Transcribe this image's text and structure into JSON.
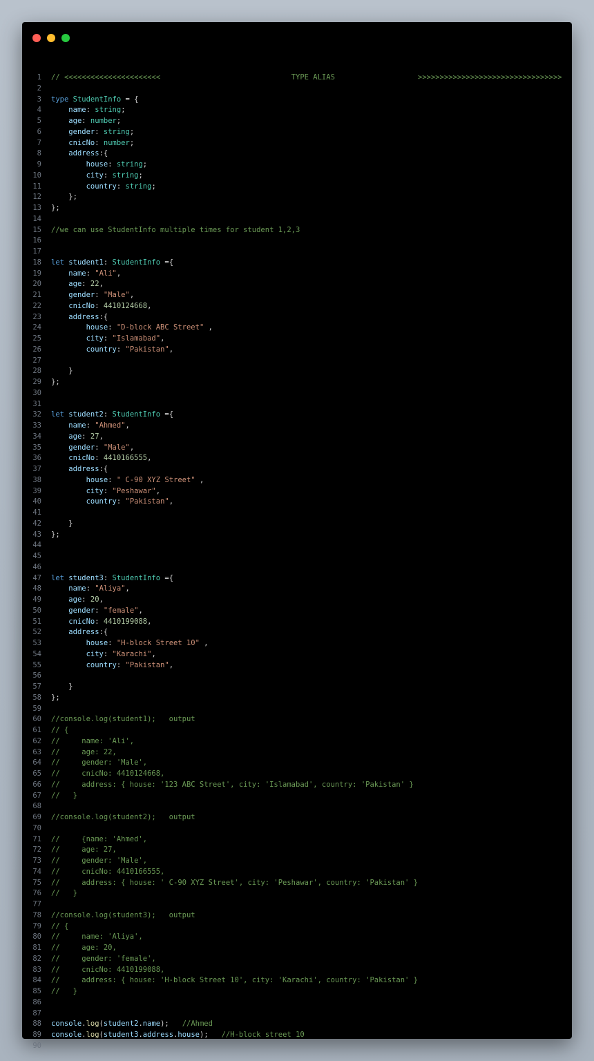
{
  "window": {
    "controls": [
      {
        "name": "close",
        "color": "#ff5f56"
      },
      {
        "name": "minimize",
        "color": "#ffbd2e"
      },
      {
        "name": "maximize",
        "color": "#27c93f"
      }
    ]
  },
  "lines": [
    [
      [
        "cm",
        "// <<<<<<<<<<<<<<<<<<<<<<                              TYPE ALIAS                   >>>>>>>>>>>>>>>>>>>>>>>>>>>>>>>>>"
      ]
    ],
    [],
    [
      [
        "kw",
        "type"
      ],
      [
        "p",
        " "
      ],
      [
        "ty",
        "StudentInfo"
      ],
      [
        "p",
        " = {"
      ]
    ],
    [
      [
        "p",
        "    "
      ],
      [
        "pr",
        "name"
      ],
      [
        "p",
        ": "
      ],
      [
        "ty",
        "string"
      ],
      [
        "p",
        ";"
      ]
    ],
    [
      [
        "p",
        "    "
      ],
      [
        "pr",
        "age"
      ],
      [
        "p",
        ": "
      ],
      [
        "ty",
        "number"
      ],
      [
        "p",
        ";"
      ]
    ],
    [
      [
        "p",
        "    "
      ],
      [
        "pr",
        "gender"
      ],
      [
        "p",
        ": "
      ],
      [
        "ty",
        "string"
      ],
      [
        "p",
        ";"
      ]
    ],
    [
      [
        "p",
        "    "
      ],
      [
        "pr",
        "cnicNo"
      ],
      [
        "p",
        ": "
      ],
      [
        "ty",
        "number"
      ],
      [
        "p",
        ";"
      ]
    ],
    [
      [
        "p",
        "    "
      ],
      [
        "pr",
        "address"
      ],
      [
        "p",
        ":{"
      ]
    ],
    [
      [
        "p",
        "        "
      ],
      [
        "pr",
        "house"
      ],
      [
        "p",
        ": "
      ],
      [
        "ty",
        "string"
      ],
      [
        "p",
        ";"
      ]
    ],
    [
      [
        "p",
        "        "
      ],
      [
        "pr",
        "city"
      ],
      [
        "p",
        ": "
      ],
      [
        "ty",
        "string"
      ],
      [
        "p",
        ";"
      ]
    ],
    [
      [
        "p",
        "        "
      ],
      [
        "pr",
        "country"
      ],
      [
        "p",
        ": "
      ],
      [
        "ty",
        "string"
      ],
      [
        "p",
        ";"
      ]
    ],
    [
      [
        "p",
        "    };"
      ]
    ],
    [
      [
        "p",
        "};"
      ]
    ],
    [],
    [
      [
        "cm",
        "//we can use StudentInfo multiple times for student 1,2,3"
      ]
    ],
    [],
    [],
    [
      [
        "kw",
        "let"
      ],
      [
        "p",
        " "
      ],
      [
        "pr",
        "student1"
      ],
      [
        "p",
        ": "
      ],
      [
        "ty",
        "StudentInfo"
      ],
      [
        "p",
        " ={"
      ]
    ],
    [
      [
        "p",
        "    "
      ],
      [
        "pr",
        "name"
      ],
      [
        "p",
        ": "
      ],
      [
        "st",
        "\"Ali\""
      ],
      [
        "p",
        ","
      ]
    ],
    [
      [
        "p",
        "    "
      ],
      [
        "pr",
        "age"
      ],
      [
        "p",
        ": "
      ],
      [
        "nu",
        "22"
      ],
      [
        "p",
        ","
      ]
    ],
    [
      [
        "p",
        "    "
      ],
      [
        "pr",
        "gender"
      ],
      [
        "p",
        ": "
      ],
      [
        "st",
        "\"Male\""
      ],
      [
        "p",
        ","
      ]
    ],
    [
      [
        "p",
        "    "
      ],
      [
        "pr",
        "cnicNo"
      ],
      [
        "p",
        ": "
      ],
      [
        "nu",
        "4410124668"
      ],
      [
        "p",
        ","
      ]
    ],
    [
      [
        "p",
        "    "
      ],
      [
        "pr",
        "address"
      ],
      [
        "p",
        ":{"
      ]
    ],
    [
      [
        "p",
        "        "
      ],
      [
        "pr",
        "house"
      ],
      [
        "p",
        ": "
      ],
      [
        "st",
        "\"D-block ABC Street\""
      ],
      [
        "p",
        " ,"
      ]
    ],
    [
      [
        "p",
        "        "
      ],
      [
        "pr",
        "city"
      ],
      [
        "p",
        ": "
      ],
      [
        "st",
        "\"Islamabad\""
      ],
      [
        "p",
        ","
      ]
    ],
    [
      [
        "p",
        "        "
      ],
      [
        "pr",
        "country"
      ],
      [
        "p",
        ": "
      ],
      [
        "st",
        "\"Pakistan\""
      ],
      [
        "p",
        ","
      ]
    ],
    [],
    [
      [
        "p",
        "    }"
      ]
    ],
    [
      [
        "p",
        "};"
      ]
    ],
    [],
    [],
    [
      [
        "kw",
        "let"
      ],
      [
        "p",
        " "
      ],
      [
        "pr",
        "student2"
      ],
      [
        "p",
        ": "
      ],
      [
        "ty",
        "StudentInfo"
      ],
      [
        "p",
        " ={"
      ]
    ],
    [
      [
        "p",
        "    "
      ],
      [
        "pr",
        "name"
      ],
      [
        "p",
        ": "
      ],
      [
        "st",
        "\"Ahmed\""
      ],
      [
        "p",
        ","
      ]
    ],
    [
      [
        "p",
        "    "
      ],
      [
        "pr",
        "age"
      ],
      [
        "p",
        ": "
      ],
      [
        "nu",
        "27"
      ],
      [
        "p",
        ","
      ]
    ],
    [
      [
        "p",
        "    "
      ],
      [
        "pr",
        "gender"
      ],
      [
        "p",
        ": "
      ],
      [
        "st",
        "\"Male\""
      ],
      [
        "p",
        ","
      ]
    ],
    [
      [
        "p",
        "    "
      ],
      [
        "pr",
        "cnicNo"
      ],
      [
        "p",
        ": "
      ],
      [
        "nu",
        "4410166555"
      ],
      [
        "p",
        ","
      ]
    ],
    [
      [
        "p",
        "    "
      ],
      [
        "pr",
        "address"
      ],
      [
        "p",
        ":{"
      ]
    ],
    [
      [
        "p",
        "        "
      ],
      [
        "pr",
        "house"
      ],
      [
        "p",
        ": "
      ],
      [
        "st",
        "\" C-90 XYZ Street\""
      ],
      [
        "p",
        " ,"
      ]
    ],
    [
      [
        "p",
        "        "
      ],
      [
        "pr",
        "city"
      ],
      [
        "p",
        ": "
      ],
      [
        "st",
        "\"Peshawar\""
      ],
      [
        "p",
        ","
      ]
    ],
    [
      [
        "p",
        "        "
      ],
      [
        "pr",
        "country"
      ],
      [
        "p",
        ": "
      ],
      [
        "st",
        "\"Pakistan\""
      ],
      [
        "p",
        ","
      ]
    ],
    [],
    [
      [
        "p",
        "    }"
      ]
    ],
    [
      [
        "p",
        "};"
      ]
    ],
    [],
    [],
    [],
    [
      [
        "kw",
        "let"
      ],
      [
        "p",
        " "
      ],
      [
        "pr",
        "student3"
      ],
      [
        "p",
        ": "
      ],
      [
        "ty",
        "StudentInfo"
      ],
      [
        "p",
        " ={"
      ]
    ],
    [
      [
        "p",
        "    "
      ],
      [
        "pr",
        "name"
      ],
      [
        "p",
        ": "
      ],
      [
        "st",
        "\"Aliya\""
      ],
      [
        "p",
        ","
      ]
    ],
    [
      [
        "p",
        "    "
      ],
      [
        "pr",
        "age"
      ],
      [
        "p",
        ": "
      ],
      [
        "nu",
        "20"
      ],
      [
        "p",
        ","
      ]
    ],
    [
      [
        "p",
        "    "
      ],
      [
        "pr",
        "gender"
      ],
      [
        "p",
        ": "
      ],
      [
        "st",
        "\"female\""
      ],
      [
        "p",
        ","
      ]
    ],
    [
      [
        "p",
        "    "
      ],
      [
        "pr",
        "cnicNo"
      ],
      [
        "p",
        ": "
      ],
      [
        "nu",
        "4410199088"
      ],
      [
        "p",
        ","
      ]
    ],
    [
      [
        "p",
        "    "
      ],
      [
        "pr",
        "address"
      ],
      [
        "p",
        ":{"
      ]
    ],
    [
      [
        "p",
        "        "
      ],
      [
        "pr",
        "house"
      ],
      [
        "p",
        ": "
      ],
      [
        "st",
        "\"H-block Street 10\""
      ],
      [
        "p",
        " ,"
      ]
    ],
    [
      [
        "p",
        "        "
      ],
      [
        "pr",
        "city"
      ],
      [
        "p",
        ": "
      ],
      [
        "st",
        "\"Karachi\""
      ],
      [
        "p",
        ","
      ]
    ],
    [
      [
        "p",
        "        "
      ],
      [
        "pr",
        "country"
      ],
      [
        "p",
        ": "
      ],
      [
        "st",
        "\"Pakistan\""
      ],
      [
        "p",
        ","
      ]
    ],
    [],
    [
      [
        "p",
        "    }"
      ]
    ],
    [
      [
        "p",
        "};"
      ]
    ],
    [],
    [
      [
        "cm",
        "//console.log(student1);   output"
      ]
    ],
    [
      [
        "cm",
        "// {"
      ]
    ],
    [
      [
        "cm",
        "//     name: 'Ali',"
      ]
    ],
    [
      [
        "cm",
        "//     age: 22,"
      ]
    ],
    [
      [
        "cm",
        "//     gender: 'Male',"
      ]
    ],
    [
      [
        "cm",
        "//     cnicNo: 4410124668,"
      ]
    ],
    [
      [
        "cm",
        "//     address: { house: '123 ABC Street', city: 'Islamabad', country: 'Pakistan' }"
      ]
    ],
    [
      [
        "cm",
        "//   }"
      ]
    ],
    [],
    [
      [
        "cm",
        "//console.log(student2);   output"
      ]
    ],
    [],
    [
      [
        "cm",
        "//     {name: 'Ahmed',"
      ]
    ],
    [
      [
        "cm",
        "//     age: 27,"
      ]
    ],
    [
      [
        "cm",
        "//     gender: 'Male',"
      ]
    ],
    [
      [
        "cm",
        "//     cnicNo: 4410166555,"
      ]
    ],
    [
      [
        "cm",
        "//     address: { house: ' C-90 XYZ Street', city: 'Peshawar', country: 'Pakistan' }"
      ]
    ],
    [
      [
        "cm",
        "//   }"
      ]
    ],
    [],
    [
      [
        "cm",
        "//console.log(student3);   output"
      ]
    ],
    [
      [
        "cm",
        "// {"
      ]
    ],
    [
      [
        "cm",
        "//     name: 'Aliya',"
      ]
    ],
    [
      [
        "cm",
        "//     age: 20,"
      ]
    ],
    [
      [
        "cm",
        "//     gender: 'female',"
      ]
    ],
    [
      [
        "cm",
        "//     cnicNo: 4410199088,"
      ]
    ],
    [
      [
        "cm",
        "//     address: { house: 'H-block Street 10', city: 'Karachi', country: 'Pakistan' }"
      ]
    ],
    [
      [
        "cm",
        "//   }"
      ]
    ],
    [],
    [],
    [
      [
        "pr",
        "console"
      ],
      [
        "p",
        "."
      ],
      [
        "fn",
        "log"
      ],
      [
        "p",
        "("
      ],
      [
        "pr",
        "student2"
      ],
      [
        "p",
        "."
      ],
      [
        "pr",
        "name"
      ],
      [
        "p",
        ");   "
      ],
      [
        "cm",
        "//Ahmed"
      ]
    ],
    [
      [
        "pr",
        "console"
      ],
      [
        "p",
        "."
      ],
      [
        "fn",
        "log"
      ],
      [
        "p",
        "("
      ],
      [
        "pr",
        "student3"
      ],
      [
        "p",
        "."
      ],
      [
        "pr",
        "address"
      ],
      [
        "p",
        "."
      ],
      [
        "pr",
        "house"
      ],
      [
        "p",
        ");   "
      ],
      [
        "cm",
        "//H-block street 10"
      ]
    ],
    []
  ]
}
